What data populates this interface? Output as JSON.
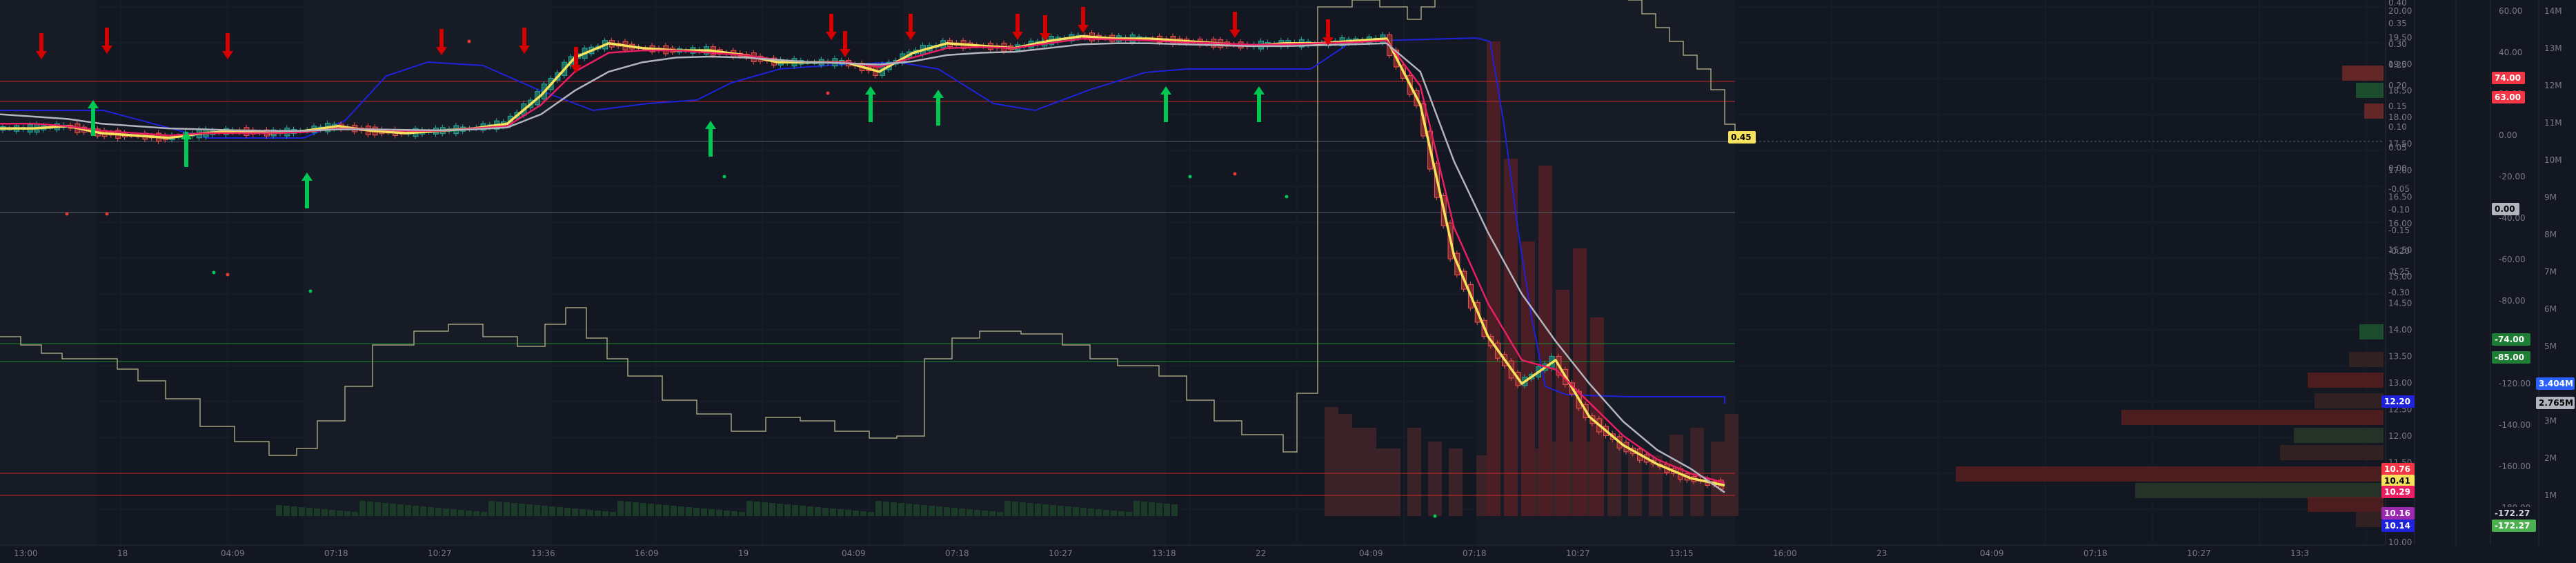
{
  "chart_data": {
    "type": "line",
    "title": "",
    "x_ticks": [
      "13:00",
      "18",
      "04:09",
      "07:18",
      "10:27",
      "13:36",
      "16:09",
      "19",
      "04:09",
      "07:18",
      "10:27",
      "13:18",
      "22",
      "04:09",
      "07:18",
      "10:27",
      "13:15",
      "16:00",
      "23",
      "04:09",
      "07:18",
      "10:27",
      "13:3"
    ],
    "y_axis_price": [
      "20.00",
      "19.50",
      "19.00",
      "18.50",
      "18.00",
      "17.50",
      "17.00",
      "16.50",
      "16.00",
      "15.50",
      "15.00",
      "14.50",
      "14.00",
      "13.50",
      "13.00",
      "12.50",
      "12.00",
      "11.50",
      "11.00",
      "10.50",
      "10.00"
    ],
    "y_axis_oscillator": [
      "0.40",
      "0.35",
      "0.30",
      "0.25",
      "0.20",
      "0.15",
      "0.10",
      "0.05",
      "0.00",
      "-0.05",
      "-0.10",
      "-0.15",
      "-0.20",
      "-0.25",
      "-0.30"
    ],
    "y_axis_indicator": [
      "60.00",
      "40.00",
      "20.00",
      "0.00",
      "-20.00",
      "-40.00",
      "-60.00",
      "-80.00",
      "-100.00",
      "-120.00",
      "-140.00",
      "-160.00",
      "-180.00"
    ],
    "y_axis_volume": [
      "14M",
      "13M",
      "12M",
      "11M",
      "10M",
      "9M",
      "8M",
      "7M",
      "6M",
      "5M",
      "4M",
      "3M",
      "2M",
      "1M"
    ],
    "y_ranges": {
      "price": [
        9.5,
        20.3
      ],
      "oscillator": [
        -0.3,
        0.42
      ],
      "indicator": [
        -190,
        70
      ]
    },
    "series": [
      {
        "name": "",
        "color": "#f7e25c",
        "values": [
          17.7,
          17.7,
          17.75,
          17.6,
          17.55,
          17.5,
          17.6,
          17.65,
          17.6,
          17.65,
          17.75,
          17.65,
          17.6,
          17.65,
          17.7,
          17.8,
          18.4,
          19.2,
          19.5,
          19.4,
          19.35,
          19.35,
          19.25,
          19.1,
          19.1,
          19.1,
          18.9,
          19.3,
          19.5,
          19.45,
          19.4,
          19.55,
          19.65,
          19.6,
          19.6,
          19.55,
          19.5,
          19.45,
          19.5,
          19.5,
          19.55,
          19.6,
          18.2,
          15.0,
          13.3,
          12.3,
          12.8,
          11.6,
          11.0,
          10.6,
          10.3,
          10.15
        ]
      },
      {
        "name": "",
        "color": "#e91e63",
        "values": [
          17.8,
          17.8,
          17.75,
          17.65,
          17.6,
          17.55,
          17.6,
          17.6,
          17.6,
          17.62,
          17.7,
          17.68,
          17.65,
          17.65,
          17.7,
          17.75,
          18.2,
          18.9,
          19.3,
          19.35,
          19.35,
          19.3,
          19.25,
          19.15,
          19.1,
          19.1,
          19.0,
          19.2,
          19.4,
          19.42,
          19.4,
          19.5,
          19.6,
          19.58,
          19.56,
          19.52,
          19.5,
          19.47,
          19.48,
          19.5,
          19.52,
          19.56,
          18.6,
          15.6,
          14.0,
          12.8,
          12.6,
          11.9,
          11.2,
          10.7,
          10.4,
          10.2
        ]
      },
      {
        "name": "",
        "color": "#b2b5be",
        "values": [
          18.0,
          17.95,
          17.9,
          17.8,
          17.75,
          17.7,
          17.68,
          17.66,
          17.65,
          17.65,
          17.68,
          17.68,
          17.67,
          17.66,
          17.68,
          17.72,
          18.0,
          18.5,
          18.9,
          19.1,
          19.2,
          19.22,
          19.2,
          19.15,
          19.1,
          19.08,
          19.05,
          19.12,
          19.25,
          19.3,
          19.32,
          19.4,
          19.48,
          19.5,
          19.5,
          19.48,
          19.46,
          19.44,
          19.44,
          19.46,
          19.48,
          19.5,
          18.9,
          17.0,
          15.5,
          14.2,
          13.2,
          12.3,
          11.5,
          10.9,
          10.5,
          10.0
        ]
      }
    ],
    "price_tags": [
      {
        "label": "0.45",
        "bg": "#f7e25c",
        "fg": "#000000"
      },
      {
        "label": "10.76",
        "bg": "#f23645",
        "fg": "#ffffff"
      },
      {
        "label": "10.41",
        "bg": "#f7e25c",
        "fg": "#000000"
      },
      {
        "label": "10.29",
        "bg": "#e91e63",
        "fg": "#ffffff"
      },
      {
        "label": "10.16",
        "bg": "#9c27b0",
        "fg": "#ffffff"
      },
      {
        "label": "10.14",
        "bg": "#1e22d8",
        "fg": "#ffffff"
      },
      {
        "label": "12.20",
        "bg": "#1e22d8",
        "fg": "#ffffff"
      },
      {
        "label": "74.00",
        "bg": "#f23645",
        "fg": "#ffffff"
      },
      {
        "label": "63.00",
        "bg": "#f23645",
        "fg": "#ffffff"
      },
      {
        "label": "0.00",
        "bg": "#b2b5be",
        "fg": "#000000"
      },
      {
        "label": "-74.00",
        "bg": "#1e7e34",
        "fg": "#ffffff"
      },
      {
        "label": "-85.00",
        "bg": "#1e7e34",
        "fg": "#ffffff"
      },
      {
        "label": "-172.27",
        "bg": "#131722",
        "fg": "#d1d4dc"
      },
      {
        "label": "-172.27",
        "bg": "#4caf50",
        "fg": "#ffffff"
      },
      {
        "label": "3.404M",
        "bg": "#2962ff",
        "fg": "#ffffff"
      },
      {
        "label": "2.765M",
        "bg": "#b2b5be",
        "fg": "#000000"
      }
    ],
    "colors": {
      "background": "#131722",
      "grid": "#1e2230",
      "bullish": "#26a69a",
      "bearish": "#ef5350",
      "upper_band": "#1e22d8"
    },
    "grid": true,
    "legend": "none"
  }
}
